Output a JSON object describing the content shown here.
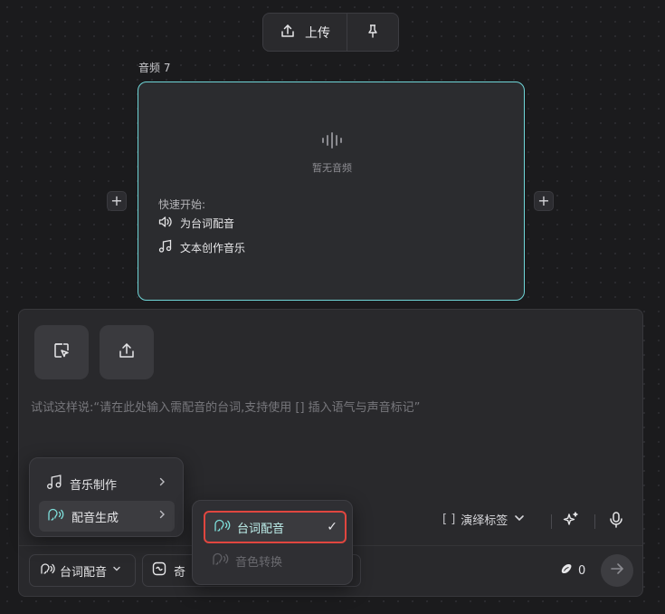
{
  "toolbar": {
    "upload_label": "上传",
    "upload_icon": "upload-icon",
    "pin_icon": "pin-icon"
  },
  "node": {
    "title": "音频 7",
    "empty_text": "暂无音频",
    "quick_start_label": "快速开始:",
    "quick_items": [
      {
        "label": "为台词配音",
        "icon": "speaker-icon"
      },
      {
        "label": "文本创作音乐",
        "icon": "music-note-icon"
      }
    ],
    "add_symbol": "+"
  },
  "input": {
    "prompt": "试试这样说:“请在此处输入需配音的台词,支持使用 [] 插入语气与声音标记”",
    "tag_brackets": "[ ]",
    "tag_label": "演绎标签",
    "mode_label": "台词配音",
    "model_label": "奇",
    "credits": "0"
  },
  "menu": {
    "items": [
      {
        "label": "音乐制作",
        "icon": "music-note-icon"
      },
      {
        "label": "配音生成",
        "icon": "voice-icon"
      }
    ]
  },
  "submenu": {
    "items": [
      {
        "label": "台词配音",
        "selected": true,
        "check": "✓"
      },
      {
        "label": "音色转换",
        "selected": false
      }
    ]
  },
  "colors": {
    "accent": "#6fd6d8",
    "highlight_border": "#e0463f",
    "background": "#1b1b1d"
  }
}
